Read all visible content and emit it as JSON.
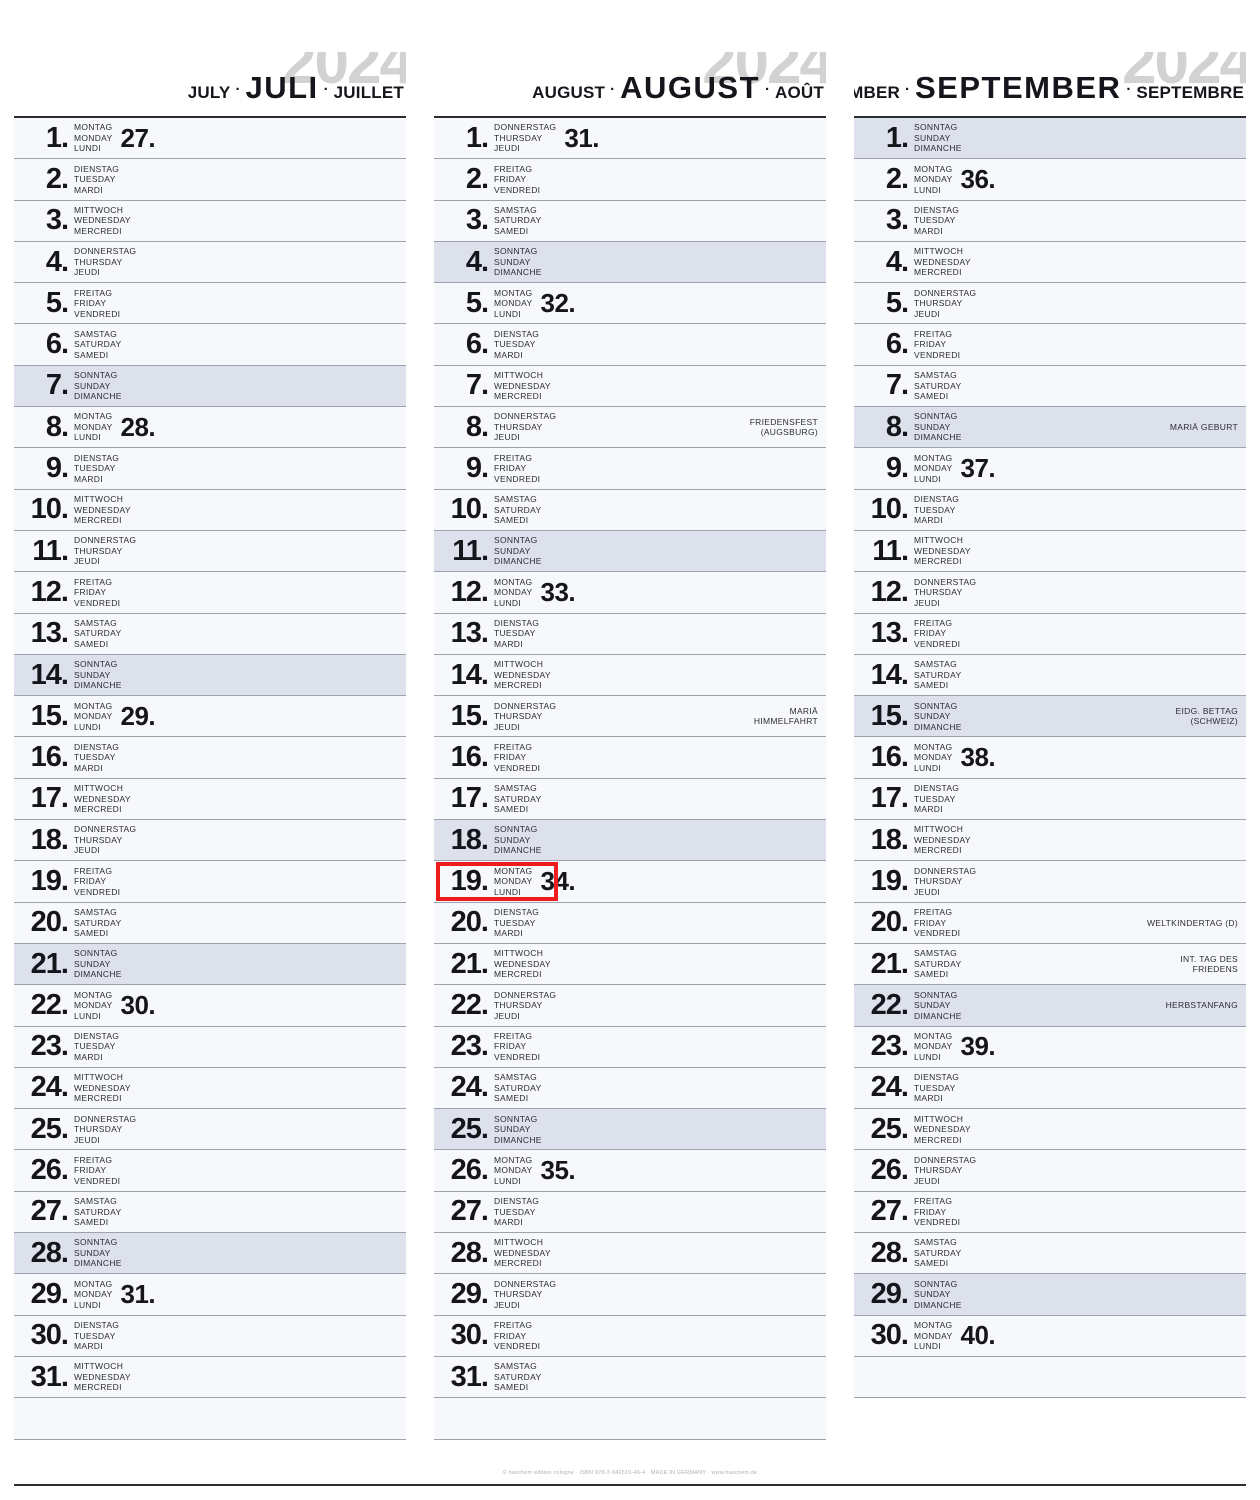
{
  "year": "2024",
  "colors": {
    "sunday_bg": "#dde1ec",
    "row_bg": "#f7f8fb",
    "ink": "#15161c",
    "highlight": "#ee1c1c",
    "year_ghost": "#d2d2d2"
  },
  "footer": {
    "text": "© haschem edition cologne · ISBN 978-3-942619-46-4 · MADE IN GERMANY · www.haschem.de"
  },
  "months": [
    {
      "name_en": "JULY",
      "name_de": "JULI",
      "name_fr": "JUILLET",
      "year": "2024",
      "days": [
        {
          "num": "1.",
          "de": "MONTAG",
          "en": "MONDAY",
          "fr": "LUNDI",
          "week": "27.",
          "sunday": false,
          "note": ""
        },
        {
          "num": "2.",
          "de": "DIENSTAG",
          "en": "TUESDAY",
          "fr": "MARDI",
          "week": "",
          "sunday": false,
          "note": ""
        },
        {
          "num": "3.",
          "de": "MITTWOCH",
          "en": "WEDNESDAY",
          "fr": "MERCREDI",
          "week": "",
          "sunday": false,
          "note": ""
        },
        {
          "num": "4.",
          "de": "DONNERSTAG",
          "en": "THURSDAY",
          "fr": "JEUDI",
          "week": "",
          "sunday": false,
          "note": ""
        },
        {
          "num": "5.",
          "de": "FREITAG",
          "en": "FRIDAY",
          "fr": "VENDREDI",
          "week": "",
          "sunday": false,
          "note": ""
        },
        {
          "num": "6.",
          "de": "SAMSTAG",
          "en": "SATURDAY",
          "fr": "SAMEDI",
          "week": "",
          "sunday": false,
          "note": ""
        },
        {
          "num": "7.",
          "de": "SONNTAG",
          "en": "SUNDAY",
          "fr": "DIMANCHE",
          "week": "",
          "sunday": true,
          "note": ""
        },
        {
          "num": "8.",
          "de": "MONTAG",
          "en": "MONDAY",
          "fr": "LUNDI",
          "week": "28.",
          "sunday": false,
          "note": ""
        },
        {
          "num": "9.",
          "de": "DIENSTAG",
          "en": "TUESDAY",
          "fr": "MARDI",
          "week": "",
          "sunday": false,
          "note": ""
        },
        {
          "num": "10.",
          "de": "MITTWOCH",
          "en": "WEDNESDAY",
          "fr": "MERCREDI",
          "week": "",
          "sunday": false,
          "note": ""
        },
        {
          "num": "11.",
          "de": "DONNERSTAG",
          "en": "THURSDAY",
          "fr": "JEUDI",
          "week": "",
          "sunday": false,
          "note": ""
        },
        {
          "num": "12.",
          "de": "FREITAG",
          "en": "FRIDAY",
          "fr": "VENDREDI",
          "week": "",
          "sunday": false,
          "note": ""
        },
        {
          "num": "13.",
          "de": "SAMSTAG",
          "en": "SATURDAY",
          "fr": "SAMEDI",
          "week": "",
          "sunday": false,
          "note": ""
        },
        {
          "num": "14.",
          "de": "SONNTAG",
          "en": "SUNDAY",
          "fr": "DIMANCHE",
          "week": "",
          "sunday": true,
          "note": ""
        },
        {
          "num": "15.",
          "de": "MONTAG",
          "en": "MONDAY",
          "fr": "LUNDI",
          "week": "29.",
          "sunday": false,
          "note": ""
        },
        {
          "num": "16.",
          "de": "DIENSTAG",
          "en": "TUESDAY",
          "fr": "MARDI",
          "week": "",
          "sunday": false,
          "note": ""
        },
        {
          "num": "17.",
          "de": "MITTWOCH",
          "en": "WEDNESDAY",
          "fr": "MERCREDI",
          "week": "",
          "sunday": false,
          "note": ""
        },
        {
          "num": "18.",
          "de": "DONNERSTAG",
          "en": "THURSDAY",
          "fr": "JEUDI",
          "week": "",
          "sunday": false,
          "note": ""
        },
        {
          "num": "19.",
          "de": "FREITAG",
          "en": "FRIDAY",
          "fr": "VENDREDI",
          "week": "",
          "sunday": false,
          "note": ""
        },
        {
          "num": "20.",
          "de": "SAMSTAG",
          "en": "SATURDAY",
          "fr": "SAMEDI",
          "week": "",
          "sunday": false,
          "note": ""
        },
        {
          "num": "21.",
          "de": "SONNTAG",
          "en": "SUNDAY",
          "fr": "DIMANCHE",
          "week": "",
          "sunday": true,
          "note": ""
        },
        {
          "num": "22.",
          "de": "MONTAG",
          "en": "MONDAY",
          "fr": "LUNDI",
          "week": "30.",
          "sunday": false,
          "note": ""
        },
        {
          "num": "23.",
          "de": "DIENSTAG",
          "en": "TUESDAY",
          "fr": "MARDI",
          "week": "",
          "sunday": false,
          "note": ""
        },
        {
          "num": "24.",
          "de": "MITTWOCH",
          "en": "WEDNESDAY",
          "fr": "MERCREDI",
          "week": "",
          "sunday": false,
          "note": ""
        },
        {
          "num": "25.",
          "de": "DONNERSTAG",
          "en": "THURSDAY",
          "fr": "JEUDI",
          "week": "",
          "sunday": false,
          "note": ""
        },
        {
          "num": "26.",
          "de": "FREITAG",
          "en": "FRIDAY",
          "fr": "VENDREDI",
          "week": "",
          "sunday": false,
          "note": ""
        },
        {
          "num": "27.",
          "de": "SAMSTAG",
          "en": "SATURDAY",
          "fr": "SAMEDI",
          "week": "",
          "sunday": false,
          "note": ""
        },
        {
          "num": "28.",
          "de": "SONNTAG",
          "en": "SUNDAY",
          "fr": "DIMANCHE",
          "week": "",
          "sunday": true,
          "note": ""
        },
        {
          "num": "29.",
          "de": "MONTAG",
          "en": "MONDAY",
          "fr": "LUNDI",
          "week": "31.",
          "sunday": false,
          "note": ""
        },
        {
          "num": "30.",
          "de": "DIENSTAG",
          "en": "TUESDAY",
          "fr": "MARDI",
          "week": "",
          "sunday": false,
          "note": ""
        },
        {
          "num": "31.",
          "de": "MITTWOCH",
          "en": "WEDNESDAY",
          "fr": "MERCREDI",
          "week": "",
          "sunday": false,
          "note": ""
        }
      ]
    },
    {
      "name_en": "AUGUST",
      "name_de": "AUGUST",
      "name_fr": "AOÛT",
      "year": "2024",
      "days": [
        {
          "num": "1.",
          "de": "DONNERSTAG",
          "en": "THURSDAY",
          "fr": "JEUDI",
          "week": "31.",
          "sunday": false,
          "note": ""
        },
        {
          "num": "2.",
          "de": "FREITAG",
          "en": "FRIDAY",
          "fr": "VENDREDI",
          "week": "",
          "sunday": false,
          "note": ""
        },
        {
          "num": "3.",
          "de": "SAMSTAG",
          "en": "SATURDAY",
          "fr": "SAMEDI",
          "week": "",
          "sunday": false,
          "note": ""
        },
        {
          "num": "4.",
          "de": "SONNTAG",
          "en": "SUNDAY",
          "fr": "DIMANCHE",
          "week": "",
          "sunday": true,
          "note": ""
        },
        {
          "num": "5.",
          "de": "MONTAG",
          "en": "MONDAY",
          "fr": "LUNDI",
          "week": "32.",
          "sunday": false,
          "note": ""
        },
        {
          "num": "6.",
          "de": "DIENSTAG",
          "en": "TUESDAY",
          "fr": "MARDI",
          "week": "",
          "sunday": false,
          "note": ""
        },
        {
          "num": "7.",
          "de": "MITTWOCH",
          "en": "WEDNESDAY",
          "fr": "MERCREDI",
          "week": "",
          "sunday": false,
          "note": ""
        },
        {
          "num": "8.",
          "de": "DONNERSTAG",
          "en": "THURSDAY",
          "fr": "JEUDI",
          "week": "",
          "sunday": false,
          "note": "FRIEDENSFEST\n(AUGSBURG)"
        },
        {
          "num": "9.",
          "de": "FREITAG",
          "en": "FRIDAY",
          "fr": "VENDREDI",
          "week": "",
          "sunday": false,
          "note": ""
        },
        {
          "num": "10.",
          "de": "SAMSTAG",
          "en": "SATURDAY",
          "fr": "SAMEDI",
          "week": "",
          "sunday": false,
          "note": ""
        },
        {
          "num": "11.",
          "de": "SONNTAG",
          "en": "SUNDAY",
          "fr": "DIMANCHE",
          "week": "",
          "sunday": true,
          "note": ""
        },
        {
          "num": "12.",
          "de": "MONTAG",
          "en": "MONDAY",
          "fr": "LUNDI",
          "week": "33.",
          "sunday": false,
          "note": ""
        },
        {
          "num": "13.",
          "de": "DIENSTAG",
          "en": "TUESDAY",
          "fr": "MARDI",
          "week": "",
          "sunday": false,
          "note": ""
        },
        {
          "num": "14.",
          "de": "MITTWOCH",
          "en": "WEDNESDAY",
          "fr": "MERCREDI",
          "week": "",
          "sunday": false,
          "note": ""
        },
        {
          "num": "15.",
          "de": "DONNERSTAG",
          "en": "THURSDAY",
          "fr": "JEUDI",
          "week": "",
          "sunday": false,
          "note": "MARIÄ\nHIMMELFAHRT"
        },
        {
          "num": "16.",
          "de": "FREITAG",
          "en": "FRIDAY",
          "fr": "VENDREDI",
          "week": "",
          "sunday": false,
          "note": ""
        },
        {
          "num": "17.",
          "de": "SAMSTAG",
          "en": "SATURDAY",
          "fr": "SAMEDI",
          "week": "",
          "sunday": false,
          "note": ""
        },
        {
          "num": "18.",
          "de": "SONNTAG",
          "en": "SUNDAY",
          "fr": "DIMANCHE",
          "week": "",
          "sunday": true,
          "note": ""
        },
        {
          "num": "19.",
          "de": "MONTAG",
          "en": "MONDAY",
          "fr": "LUNDI",
          "week": "34.",
          "sunday": false,
          "note": "",
          "highlight": true
        },
        {
          "num": "20.",
          "de": "DIENSTAG",
          "en": "TUESDAY",
          "fr": "MARDI",
          "week": "",
          "sunday": false,
          "note": ""
        },
        {
          "num": "21.",
          "de": "MITTWOCH",
          "en": "WEDNESDAY",
          "fr": "MERCREDI",
          "week": "",
          "sunday": false,
          "note": ""
        },
        {
          "num": "22.",
          "de": "DONNERSTAG",
          "en": "THURSDAY",
          "fr": "JEUDI",
          "week": "",
          "sunday": false,
          "note": ""
        },
        {
          "num": "23.",
          "de": "FREITAG",
          "en": "FRIDAY",
          "fr": "VENDREDI",
          "week": "",
          "sunday": false,
          "note": ""
        },
        {
          "num": "24.",
          "de": "SAMSTAG",
          "en": "SATURDAY",
          "fr": "SAMEDI",
          "week": "",
          "sunday": false,
          "note": ""
        },
        {
          "num": "25.",
          "de": "SONNTAG",
          "en": "SUNDAY",
          "fr": "DIMANCHE",
          "week": "",
          "sunday": true,
          "note": ""
        },
        {
          "num": "26.",
          "de": "MONTAG",
          "en": "MONDAY",
          "fr": "LUNDI",
          "week": "35.",
          "sunday": false,
          "note": ""
        },
        {
          "num": "27.",
          "de": "DIENSTAG",
          "en": "TUESDAY",
          "fr": "MARDI",
          "week": "",
          "sunday": false,
          "note": ""
        },
        {
          "num": "28.",
          "de": "MITTWOCH",
          "en": "WEDNESDAY",
          "fr": "MERCREDI",
          "week": "",
          "sunday": false,
          "note": ""
        },
        {
          "num": "29.",
          "de": "DONNERSTAG",
          "en": "THURSDAY",
          "fr": "JEUDI",
          "week": "",
          "sunday": false,
          "note": ""
        },
        {
          "num": "30.",
          "de": "FREITAG",
          "en": "FRIDAY",
          "fr": "VENDREDI",
          "week": "",
          "sunday": false,
          "note": ""
        },
        {
          "num": "31.",
          "de": "SAMSTAG",
          "en": "SATURDAY",
          "fr": "SAMEDI",
          "week": "",
          "sunday": false,
          "note": ""
        }
      ]
    },
    {
      "name_en": "SEPTEMBER",
      "name_de": "SEPTEMBER",
      "name_fr": "SEPTEMBRE",
      "year": "2024",
      "days": [
        {
          "num": "1.",
          "de": "SONNTAG",
          "en": "SUNDAY",
          "fr": "DIMANCHE",
          "week": "",
          "sunday": true,
          "note": ""
        },
        {
          "num": "2.",
          "de": "MONTAG",
          "en": "MONDAY",
          "fr": "LUNDI",
          "week": "36.",
          "sunday": false,
          "note": ""
        },
        {
          "num": "3.",
          "de": "DIENSTAG",
          "en": "TUESDAY",
          "fr": "MARDI",
          "week": "",
          "sunday": false,
          "note": ""
        },
        {
          "num": "4.",
          "de": "MITTWOCH",
          "en": "WEDNESDAY",
          "fr": "MERCREDI",
          "week": "",
          "sunday": false,
          "note": ""
        },
        {
          "num": "5.",
          "de": "DONNERSTAG",
          "en": "THURSDAY",
          "fr": "JEUDI",
          "week": "",
          "sunday": false,
          "note": ""
        },
        {
          "num": "6.",
          "de": "FREITAG",
          "en": "FRIDAY",
          "fr": "VENDREDI",
          "week": "",
          "sunday": false,
          "note": ""
        },
        {
          "num": "7.",
          "de": "SAMSTAG",
          "en": "SATURDAY",
          "fr": "SAMEDI",
          "week": "",
          "sunday": false,
          "note": ""
        },
        {
          "num": "8.",
          "de": "SONNTAG",
          "en": "SUNDAY",
          "fr": "DIMANCHE",
          "week": "",
          "sunday": true,
          "note": "MARIÄ GEBURT"
        },
        {
          "num": "9.",
          "de": "MONTAG",
          "en": "MONDAY",
          "fr": "LUNDI",
          "week": "37.",
          "sunday": false,
          "note": ""
        },
        {
          "num": "10.",
          "de": "DIENSTAG",
          "en": "TUESDAY",
          "fr": "MARDI",
          "week": "",
          "sunday": false,
          "note": ""
        },
        {
          "num": "11.",
          "de": "MITTWOCH",
          "en": "WEDNESDAY",
          "fr": "MERCREDI",
          "week": "",
          "sunday": false,
          "note": ""
        },
        {
          "num": "12.",
          "de": "DONNERSTAG",
          "en": "THURSDAY",
          "fr": "JEUDI",
          "week": "",
          "sunday": false,
          "note": ""
        },
        {
          "num": "13.",
          "de": "FREITAG",
          "en": "FRIDAY",
          "fr": "VENDREDI",
          "week": "",
          "sunday": false,
          "note": ""
        },
        {
          "num": "14.",
          "de": "SAMSTAG",
          "en": "SATURDAY",
          "fr": "SAMEDI",
          "week": "",
          "sunday": false,
          "note": ""
        },
        {
          "num": "15.",
          "de": "SONNTAG",
          "en": "SUNDAY",
          "fr": "DIMANCHE",
          "week": "",
          "sunday": true,
          "note": "EIDG. BETTAG\n(SCHWEIZ)"
        },
        {
          "num": "16.",
          "de": "MONTAG",
          "en": "MONDAY",
          "fr": "LUNDI",
          "week": "38.",
          "sunday": false,
          "note": ""
        },
        {
          "num": "17.",
          "de": "DIENSTAG",
          "en": "TUESDAY",
          "fr": "MARDI",
          "week": "",
          "sunday": false,
          "note": ""
        },
        {
          "num": "18.",
          "de": "MITTWOCH",
          "en": "WEDNESDAY",
          "fr": "MERCREDI",
          "week": "",
          "sunday": false,
          "note": ""
        },
        {
          "num": "19.",
          "de": "DONNERSTAG",
          "en": "THURSDAY",
          "fr": "JEUDI",
          "week": "",
          "sunday": false,
          "note": ""
        },
        {
          "num": "20.",
          "de": "FREITAG",
          "en": "FRIDAY",
          "fr": "VENDREDI",
          "week": "",
          "sunday": false,
          "note": "WELTKINDERTAG (D)"
        },
        {
          "num": "21.",
          "de": "SAMSTAG",
          "en": "SATURDAY",
          "fr": "SAMEDI",
          "week": "",
          "sunday": false,
          "note": "INT. TAG DES\nFRIEDENS"
        },
        {
          "num": "22.",
          "de": "SONNTAG",
          "en": "SUNDAY",
          "fr": "DIMANCHE",
          "week": "",
          "sunday": true,
          "note": "HERBSTANFANG"
        },
        {
          "num": "23.",
          "de": "MONTAG",
          "en": "MONDAY",
          "fr": "LUNDI",
          "week": "39.",
          "sunday": false,
          "note": ""
        },
        {
          "num": "24.",
          "de": "DIENSTAG",
          "en": "TUESDAY",
          "fr": "MARDI",
          "week": "",
          "sunday": false,
          "note": ""
        },
        {
          "num": "25.",
          "de": "MITTWOCH",
          "en": "WEDNESDAY",
          "fr": "MERCREDI",
          "week": "",
          "sunday": false,
          "note": ""
        },
        {
          "num": "26.",
          "de": "DONNERSTAG",
          "en": "THURSDAY",
          "fr": "JEUDI",
          "week": "",
          "sunday": false,
          "note": ""
        },
        {
          "num": "27.",
          "de": "FREITAG",
          "en": "FRIDAY",
          "fr": "VENDREDI",
          "week": "",
          "sunday": false,
          "note": ""
        },
        {
          "num": "28.",
          "de": "SAMSTAG",
          "en": "SATURDAY",
          "fr": "SAMEDI",
          "week": "",
          "sunday": false,
          "note": ""
        },
        {
          "num": "29.",
          "de": "SONNTAG",
          "en": "SUNDAY",
          "fr": "DIMANCHE",
          "week": "",
          "sunday": true,
          "note": ""
        },
        {
          "num": "30.",
          "de": "MONTAG",
          "en": "MONDAY",
          "fr": "LUNDI",
          "week": "40.",
          "sunday": false,
          "note": ""
        }
      ]
    }
  ]
}
